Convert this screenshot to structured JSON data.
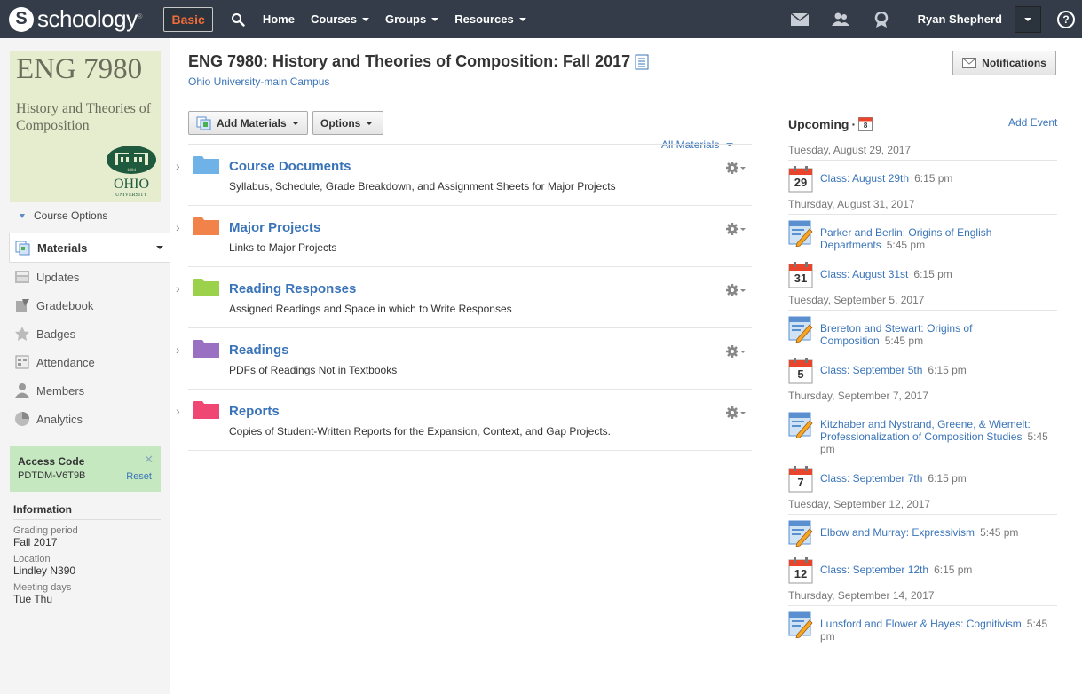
{
  "nav": {
    "logo_text": "schoology",
    "basic_label": "Basic",
    "links": [
      {
        "label": "Home",
        "dropdown": false
      },
      {
        "label": "Courses",
        "dropdown": true
      },
      {
        "label": "Groups",
        "dropdown": true
      },
      {
        "label": "Resources",
        "dropdown": true
      }
    ],
    "user_name": "Ryan Shepherd",
    "help": "?"
  },
  "course_pic": {
    "code": "ENG 7980",
    "name": "History and Theories of Composition"
  },
  "sidebar": {
    "course_options": "Course Options",
    "menu": [
      {
        "label": "Materials",
        "icon": "materials-icon",
        "active": true
      },
      {
        "label": "Updates",
        "icon": "updates-icon"
      },
      {
        "label": "Gradebook",
        "icon": "gradebook-icon"
      },
      {
        "label": "Badges",
        "icon": "badges-icon"
      },
      {
        "label": "Attendance",
        "icon": "attendance-icon"
      },
      {
        "label": "Members",
        "icon": "members-icon"
      },
      {
        "label": "Analytics",
        "icon": "analytics-icon"
      }
    ],
    "access": {
      "title": "Access Code",
      "code": "PDTDM-V6T9B",
      "reset": "Reset"
    },
    "info": {
      "title": "Information",
      "fields": [
        {
          "label": "Grading period",
          "value": "Fall 2017"
        },
        {
          "label": "Location",
          "value": "Lindley N390"
        },
        {
          "label": "Meeting days",
          "value": "Tue Thu"
        }
      ]
    }
  },
  "main": {
    "title": "ENG 7980: History and Theories of Composition: Fall 2017",
    "subtitle": "Ohio University-main Campus",
    "notifications": "Notifications",
    "add_materials": "Add Materials",
    "options": "Options",
    "all_materials": "All Materials",
    "materials": [
      {
        "title": "Course Documents",
        "desc": "Syllabus, Schedule, Grade Breakdown, and Assignment Sheets for Major Projects",
        "color": "#6fb2e6"
      },
      {
        "title": "Major Projects",
        "desc": "Links to Major Projects",
        "color": "#f0834a"
      },
      {
        "title": "Reading Responses",
        "desc": "Assigned Readings and Space in which to Write Responses",
        "color": "#9bd14b"
      },
      {
        "title": "Readings",
        "desc": "PDFs of Readings Not in Textbooks",
        "color": "#9a70c2"
      },
      {
        "title": "Reports",
        "desc": "Copies of Student-Written Reports for the Expansion, Context, and Gap Projects.",
        "color": "#ef4673"
      }
    ]
  },
  "upcoming": {
    "title": "Upcoming",
    "title_sep": "·",
    "cal_icon_num": "8",
    "add_event": "Add Event",
    "groups": [
      {
        "date": "Tuesday, August 29, 2017",
        "events": [
          {
            "type": "calendar",
            "num": "29",
            "title": "Class: August 29th",
            "time": "6:15 pm"
          }
        ]
      },
      {
        "date": "Thursday, August 31, 2017",
        "events": [
          {
            "type": "assignment",
            "title": "Parker and Berlin: Origins of English Departments",
            "time": "5:45 pm"
          },
          {
            "type": "calendar",
            "num": "31",
            "title": "Class: August 31st",
            "time": "6:15 pm"
          }
        ]
      },
      {
        "date": "Tuesday, September 5, 2017",
        "events": [
          {
            "type": "assignment",
            "title": "Brereton and Stewart: Origins of Composition",
            "time": "5:45 pm"
          },
          {
            "type": "calendar",
            "num": "5",
            "title": "Class: September 5th",
            "time": "6:15 pm"
          }
        ]
      },
      {
        "date": "Thursday, September 7, 2017",
        "events": [
          {
            "type": "assignment",
            "title": "Kitzhaber and Nystrand, Greene, & Wiemelt: Professionalization of Composition Studies",
            "time": "5:45 pm"
          },
          {
            "type": "calendar",
            "num": "7",
            "title": "Class: September 7th",
            "time": "6:15 pm"
          }
        ]
      },
      {
        "date": "Tuesday, September 12, 2017",
        "events": [
          {
            "type": "assignment",
            "title": "Elbow and Murray: Expressivism",
            "time": "5:45 pm"
          },
          {
            "type": "calendar",
            "num": "12",
            "title": "Class: September 12th",
            "time": "6:15 pm"
          }
        ]
      },
      {
        "date": "Thursday, September 14, 2017",
        "events": [
          {
            "type": "assignment",
            "title": "Lunsford and Flower & Hayes: Cognitivism",
            "time": "5:45 pm"
          }
        ]
      }
    ]
  }
}
